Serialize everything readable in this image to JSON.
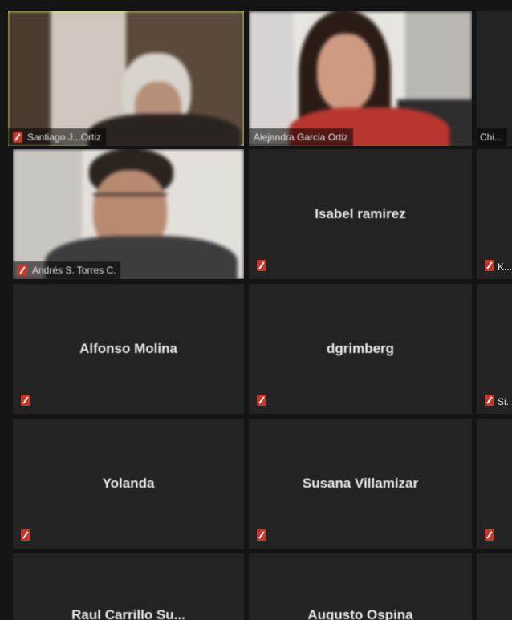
{
  "participants": [
    {
      "name": "Santiago J...Ortiz",
      "video": true,
      "active": true
    },
    {
      "name": "Alejandra Garcia Ortiz",
      "video": true,
      "active": false
    },
    {
      "name": "Andrés S. Torres C.",
      "video": true,
      "active": false
    },
    {
      "name": "Isabel ramirez",
      "video": false,
      "muted": true
    },
    {
      "name": "Alfonso Molina",
      "video": false,
      "muted": true
    },
    {
      "name": "dgrimberg",
      "video": false,
      "muted": true
    },
    {
      "name": "Yolanda",
      "video": false,
      "muted": true
    },
    {
      "name": "Susana Villamizar",
      "video": false,
      "muted": true
    },
    {
      "name": "Raul Carrillo Su...",
      "video": false
    },
    {
      "name": "Augusto Ospina",
      "video": false
    }
  ],
  "partial_column": [
    "Chi...",
    "K...",
    "Si..."
  ],
  "colors": {
    "active_border": "#c9e265",
    "tile_bg": "#232323",
    "muted": "#c0392b"
  }
}
